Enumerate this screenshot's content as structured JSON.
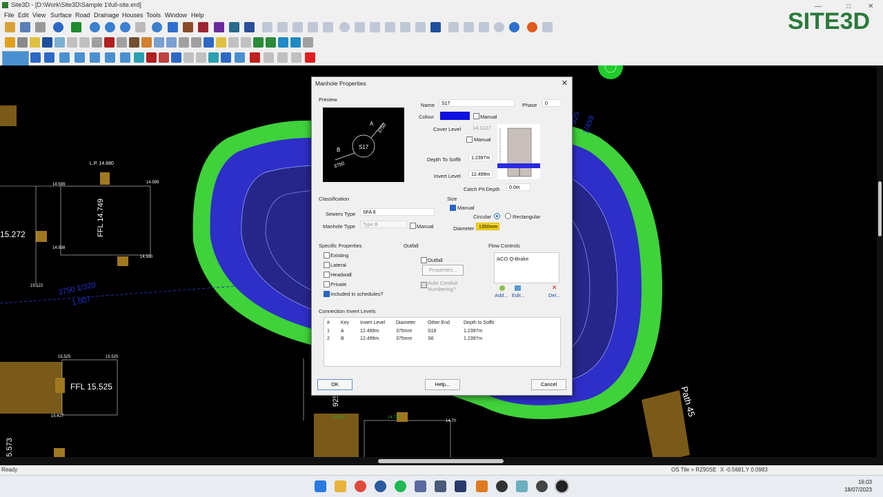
{
  "window": {
    "title": "Site3D - [D:\\Work\\Site3D\\Sample 1\\full-site.erd]",
    "controls": [
      "—",
      "□",
      "✕"
    ]
  },
  "menu": [
    "File",
    "Edit",
    "View",
    "Surface",
    "Road",
    "Drainage",
    "Houses",
    "Tools",
    "Window",
    "Help"
  ],
  "logo": "SITE3D",
  "canvas": {
    "labels": {
      "lp_top": "L.P. 14.680",
      "lv_14599a": "14.599",
      "lv_14599b": "14.599",
      "lv_14598": "14.598",
      "lv_14590": "14.590",
      "lv_15122": "15.122",
      "ffl_14749": "FFL 14.749",
      "lv_15272": "15.272",
      "pipe_label": "3750 1/320",
      "pipe_label2": "1.007",
      "lv_15525a": "15.525",
      "lv_15525b": "15.525",
      "ffl_15525": "FFL 15.525",
      "lv_15427": "15.427",
      "lv_5573": "5.573",
      "lv_925": "925",
      "lv_14700": "14.70",
      "lv_14725": "14.725",
      "lv_14525": "14.525",
      "path45": "Path 45",
      "green_top": "925",
      "green_top2": "1/459"
    }
  },
  "dialog": {
    "title": "Manhole Properties",
    "preview_label": "Preview",
    "preview": {
      "name": "S17",
      "a_label": "A",
      "a_dim": "3750",
      "b_label": "B",
      "b_dim": "3750"
    },
    "name_label": "Name",
    "name_value": "S17",
    "phase_label": "Phase",
    "phase_value": "0",
    "colour_label": "Colour",
    "colour_value": "#1010e0",
    "colour_manual": "Manual",
    "cover_level_label": "Cover Level",
    "cover_level_value": "14.1137",
    "cover_manual": "Manual",
    "depth_soffit_label": "Depth To Soffit",
    "depth_soffit_value": "1.2397m",
    "invert_level_label": "Invert Level",
    "invert_level_value": "12.499m",
    "catch_pit_label": "Catch Pit Depth",
    "catch_pit_value": "0.0m",
    "classification_label": "Classification",
    "sewers_type_label": "Sewers Type",
    "sewers_type_value": "SFA 6",
    "manhole_type_label": "Manhole Type",
    "manhole_type_value": "Type B",
    "manhole_type_manual": "Manual",
    "size_label": "Size",
    "size_manual": "Manual",
    "circular_label": "Circular",
    "rectangular_label": "Rectangular",
    "diameter_label": "Diameter",
    "diameter_value": "1350mm",
    "specific_label": "Specific Properties",
    "existing_label": "Existing",
    "lateral_label": "Lateral",
    "headwall_label": "Headwall",
    "private_label": "Private",
    "schedules_label": "Included in schedules?",
    "outfall_group": "Outfall",
    "outfall_check": "Outfall",
    "properties_btn": "Properties...",
    "auto_conduit": "Auto Conduit",
    "auto_conduit2": "Numbering?",
    "flow_controls_label": "Flow Controls",
    "flow_item": "ACO Q-Brake",
    "add_btn": "Add...",
    "edit_btn": "Edit...",
    "del_btn": "Del...",
    "connection_label": "Connection Invert Levels",
    "columns": [
      "#",
      "Key",
      "Invert Level",
      "Diameter",
      "Other End",
      "Depth to Soffit"
    ],
    "rows": [
      [
        "1",
        "A",
        "12.499m",
        "375mm",
        "S18",
        "1.2397m"
      ],
      [
        "2",
        "B",
        "12.499m",
        "375mm",
        "S6",
        "1.2397m"
      ]
    ],
    "ok_btn": "OK",
    "help_btn": "Help...",
    "cancel_btn": "Cancel"
  },
  "status": {
    "ready": "Ready",
    "tile": "OS Tile = RZ90SE",
    "coords": "X -0.5681,Y 0.0983"
  },
  "taskbar": {
    "time": "16:03",
    "date": "18/07/2023"
  }
}
